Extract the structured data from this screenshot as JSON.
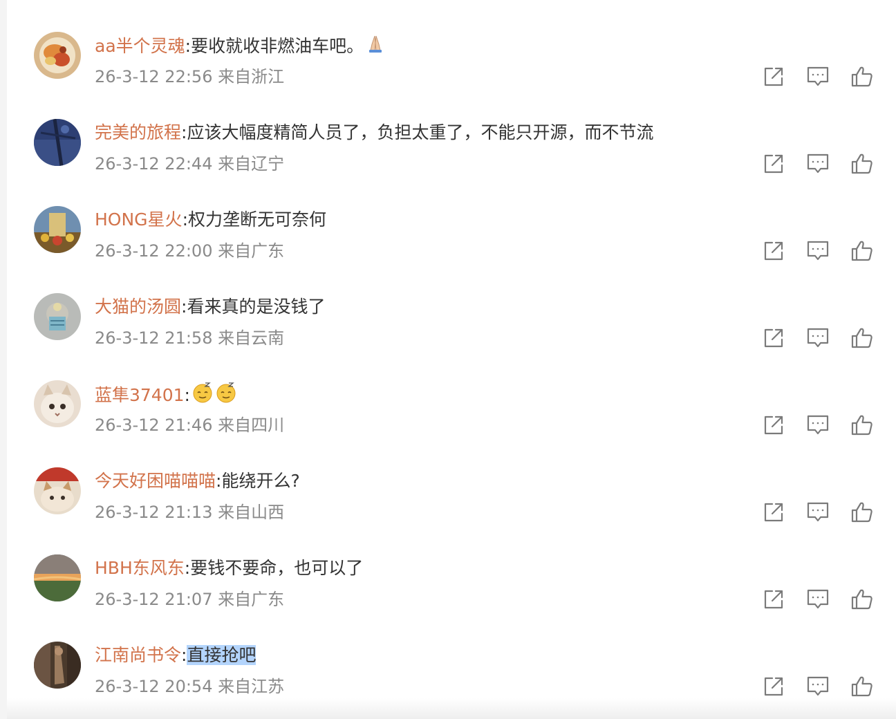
{
  "comments": [
    {
      "username": "aa半个灵魂",
      "separator": ":",
      "content": "要收就收非燃油车吧。",
      "emoji": "folded-hands-emoji",
      "time": "26-3-12 22:56",
      "location": "来自浙江"
    },
    {
      "username": "完美的旅程",
      "separator": ":",
      "content": "应该大幅度精简人员了，负担太重了，不能只开源，而不节流",
      "time": "26-3-12 22:44",
      "location": "来自辽宁"
    },
    {
      "username": "HONG星火",
      "separator": ":",
      "content": "权力垄断无可奈何",
      "time": "26-3-12 22:00",
      "location": "来自广东"
    },
    {
      "username": "大猫的汤圆",
      "separator": ":",
      "content": "看来真的是没钱了",
      "time": "26-3-12 21:58",
      "location": "来自云南"
    },
    {
      "username": "蓝隼37401",
      "separator": ":",
      "content": "",
      "emoji": "sleepy-face-emoji",
      "time": "26-3-12 21:46",
      "location": "来自四川"
    },
    {
      "username": "今天好困喵喵喵",
      "separator": ":",
      "content": "能绕开么?",
      "time": "26-3-12 21:13",
      "location": "来自山西"
    },
    {
      "username": "HBH东风东",
      "separator": ":",
      "content": "要钱不要命，也可以了",
      "time": "26-3-12 21:07",
      "location": "来自广东"
    },
    {
      "username": "江南尚书令",
      "separator": ":",
      "content": "直接抢吧",
      "time": "26-3-12 20:54",
      "location": "来自江苏"
    }
  ],
  "icons": {
    "share": "share-icon",
    "reply": "comment-icon",
    "like": "thumbs-up-icon"
  },
  "colors": {
    "username": "#d2734b",
    "text": "#333333",
    "meta": "#8a8a8a",
    "icon": "#7a7a7a",
    "selection": "#b3d4fc"
  }
}
